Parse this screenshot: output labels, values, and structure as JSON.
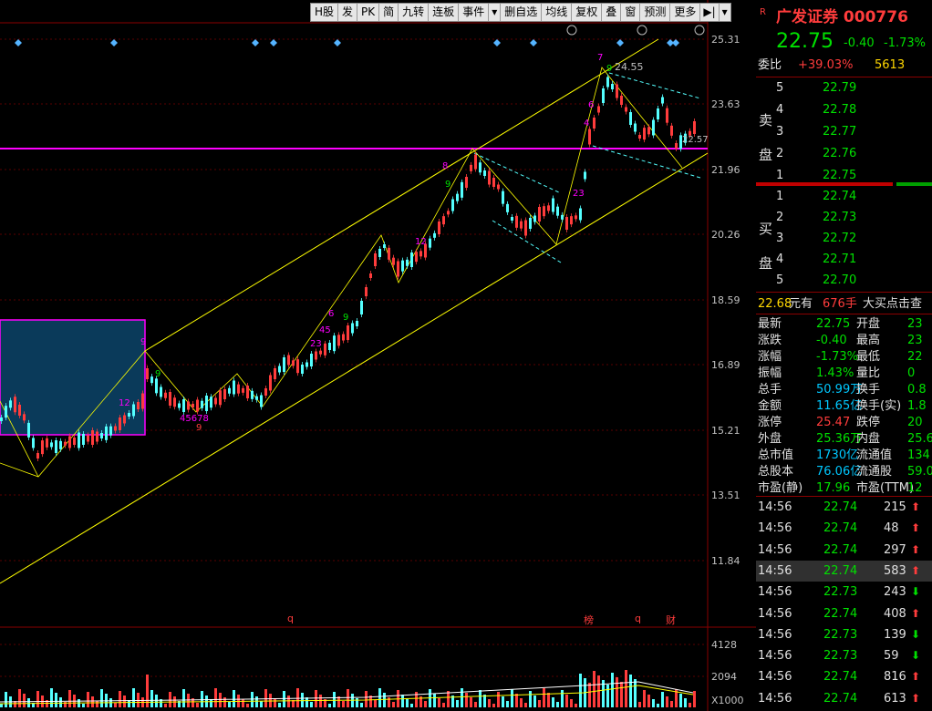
{
  "toolbar": {
    "items": [
      "H股",
      "发",
      "PK",
      "简",
      "九转",
      "连板",
      "事件",
      "删自选",
      "均线",
      "复权",
      "叠",
      "窗",
      "预测",
      "更多"
    ]
  },
  "chart": {
    "price_ticks": [
      "25.31",
      "23.63",
      "21.96",
      "20.26",
      "18.59",
      "16.89",
      "15.21",
      "13.51",
      "11.84"
    ],
    "volume_ticks": [
      "4128",
      "2094",
      "X1000"
    ],
    "high_label": "24.55",
    "current_label": "22.57",
    "event_marks": [
      "q",
      "榜",
      "q",
      "财"
    ]
  },
  "panel": {
    "flag": "R",
    "stock_name": "广发证券",
    "stock_code": "000776",
    "price": "22.75",
    "change": "-0.40",
    "change_pct": "-1.73%",
    "weibi_label": "委比",
    "weibi_value": "+39.03%",
    "weibi_count": "5613",
    "sell_label": "卖盘",
    "buy_label": "买盘",
    "asks": [
      {
        "level": "5",
        "price": "22.79"
      },
      {
        "level": "4",
        "price": "22.78"
      },
      {
        "level": "3",
        "price": "22.77"
      },
      {
        "level": "2",
        "price": "22.76"
      },
      {
        "level": "1",
        "price": "22.75"
      }
    ],
    "bids": [
      {
        "level": "1",
        "price": "22.74"
      },
      {
        "level": "2",
        "price": "22.73"
      },
      {
        "level": "3",
        "price": "22.72"
      },
      {
        "level": "4",
        "price": "22.71"
      },
      {
        "level": "5",
        "price": "22.70"
      }
    ],
    "notice": {
      "price": "22.68",
      "unit": "元有",
      "qty": "676手",
      "text": "大买点击查"
    },
    "stats": [
      {
        "l1": "最新",
        "v1": "22.75",
        "l2": "开盘",
        "v2": "23"
      },
      {
        "l1": "涨跌",
        "v1": "-0.40",
        "l2": "最高",
        "v2": "23"
      },
      {
        "l1": "涨幅",
        "v1": "-1.73%",
        "l2": "最低",
        "v2": "22"
      },
      {
        "l1": "振幅",
        "v1": "1.43%",
        "l2": "量比",
        "v2": "0"
      },
      {
        "l1": "总手",
        "v1": "50.99万",
        "l2": "换手",
        "v2": "0.8"
      },
      {
        "l1": "金额",
        "v1": "11.65亿",
        "l2": "换手(实)",
        "v2": "1.8"
      },
      {
        "l1": "涨停",
        "v1": "25.47",
        "l2": "跌停",
        "v2": "20"
      },
      {
        "l1": "外盘",
        "v1": "25.36万",
        "l2": "内盘",
        "v2": "25.6"
      },
      {
        "l1": "总市值",
        "v1": "1730亿",
        "l2": "流通值",
        "v2": "134"
      },
      {
        "l1": "总股本",
        "v1": "76.06亿",
        "l2": "流通股",
        "v2": "59.0"
      },
      {
        "l1": "市盈(静)",
        "v1": "17.96",
        "l2": "市盈(TTM)",
        "v2": "12"
      }
    ],
    "trades": [
      {
        "time": "14:56",
        "price": "22.74",
        "vol": "215",
        "dir": "up"
      },
      {
        "time": "14:56",
        "price": "22.74",
        "vol": "48",
        "dir": "up"
      },
      {
        "time": "14:56",
        "price": "22.74",
        "vol": "297",
        "dir": "up"
      },
      {
        "time": "14:56",
        "price": "22.74",
        "vol": "583",
        "dir": "up"
      },
      {
        "time": "14:56",
        "price": "22.73",
        "vol": "243",
        "dir": "down"
      },
      {
        "time": "14:56",
        "price": "22.74",
        "vol": "408",
        "dir": "up"
      },
      {
        "time": "14:56",
        "price": "22.73",
        "vol": "139",
        "dir": "down"
      },
      {
        "time": "14:56",
        "price": "22.73",
        "vol": "59",
        "dir": "down"
      },
      {
        "time": "14:56",
        "price": "22.74",
        "vol": "816",
        "dir": "up"
      },
      {
        "time": "14:56",
        "price": "22.74",
        "vol": "613",
        "dir": "up"
      }
    ]
  },
  "colors": {
    "up": "#ff3c3c",
    "down": "#00e000",
    "cyan": "#54ffff",
    "yellow": "#ffff00",
    "magenta": "#ff00ff"
  }
}
